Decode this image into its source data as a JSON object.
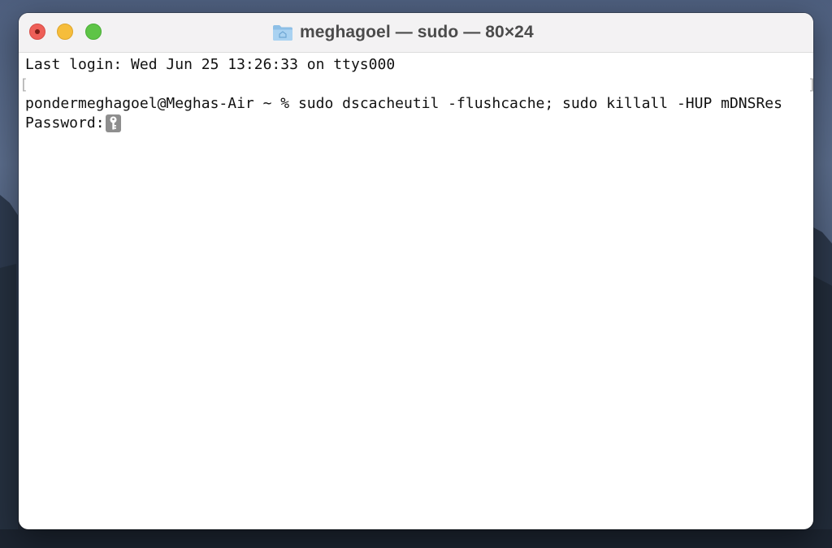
{
  "window": {
    "title": "meghagoel — sudo — 80×24",
    "folder_icon": "folder-icon"
  },
  "terminal": {
    "lines": [
      "Last login: Wed Jun 25 13:26:33 on ttys000",
      "meghagoel@Meghas-Air ~ % sudo dscacheutil -flushcache; sudo killall -HUP mDNSRes",
      "ponder",
      "Password:"
    ],
    "cursor_icon": "key-icon"
  },
  "colors": {
    "close": "#ee5f58",
    "minimize": "#f6bd3b",
    "maximize": "#5ec447",
    "titlebar": "#f3f2f3",
    "background": "#ffffff",
    "text": "#111111"
  }
}
